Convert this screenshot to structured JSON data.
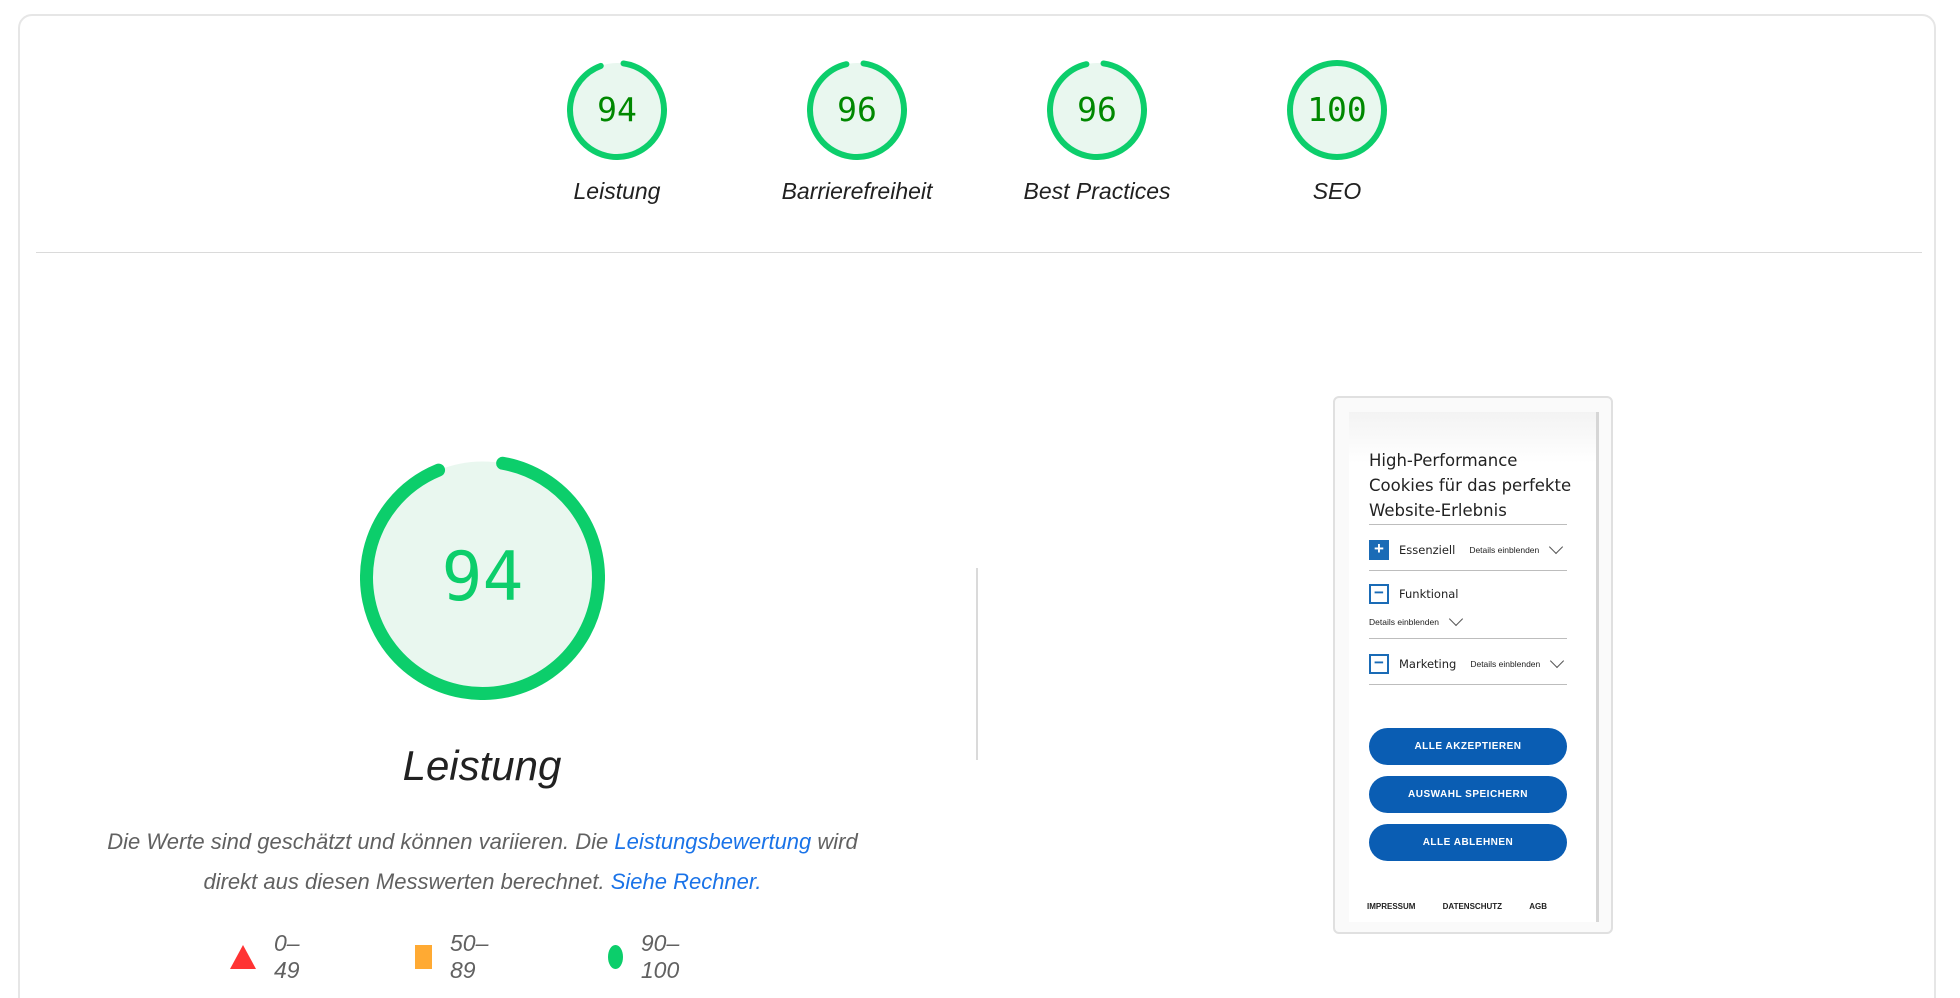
{
  "gauges": [
    {
      "score": "94",
      "label": "Leistung",
      "value": 94,
      "color": "#0cce6b"
    },
    {
      "score": "96",
      "label": "Barrierefreiheit",
      "value": 96,
      "color": "#0cce6b"
    },
    {
      "score": "96",
      "label": "Best Practices",
      "value": 96,
      "color": "#0cce6b"
    },
    {
      "score": "100",
      "label": "SEO",
      "value": 100,
      "color": "#0cce6b"
    }
  ],
  "main": {
    "score": "94",
    "value": 94,
    "title": "Leistung",
    "desc_part1": "Die Werte sind geschätzt und können variieren. Die ",
    "desc_link1": "Leistungsbewertung",
    "desc_part2": " wird direkt aus diesen Messwerten berechnet. ",
    "desc_link2": "Siehe Rechner."
  },
  "legend": [
    {
      "range": "0–49",
      "icon": "red-triangle-icon",
      "color": "#ff3333"
    },
    {
      "range": "50–89",
      "icon": "orange-square-icon",
      "color": "#ffaa33"
    },
    {
      "range": "90–100",
      "icon": "green-circle-icon",
      "color": "#0cce6b"
    }
  ],
  "screenshot": {
    "title": "High-Performance Cookies für das perfekte Website-Erlebnis",
    "options": [
      {
        "name": "Essenziell",
        "details": "Details einblenden"
      },
      {
        "name": "Funktional",
        "details": "Details einblenden"
      },
      {
        "name": "Marketing",
        "details": "Details einblenden"
      }
    ],
    "buttons": [
      "ALLE AKZEPTIEREN",
      "AUSWAHL SPEICHERN",
      "ALLE ABLEHNEN"
    ],
    "footer": [
      "IMPRESSUM",
      "DATENSCHUTZ",
      "AGB"
    ]
  }
}
